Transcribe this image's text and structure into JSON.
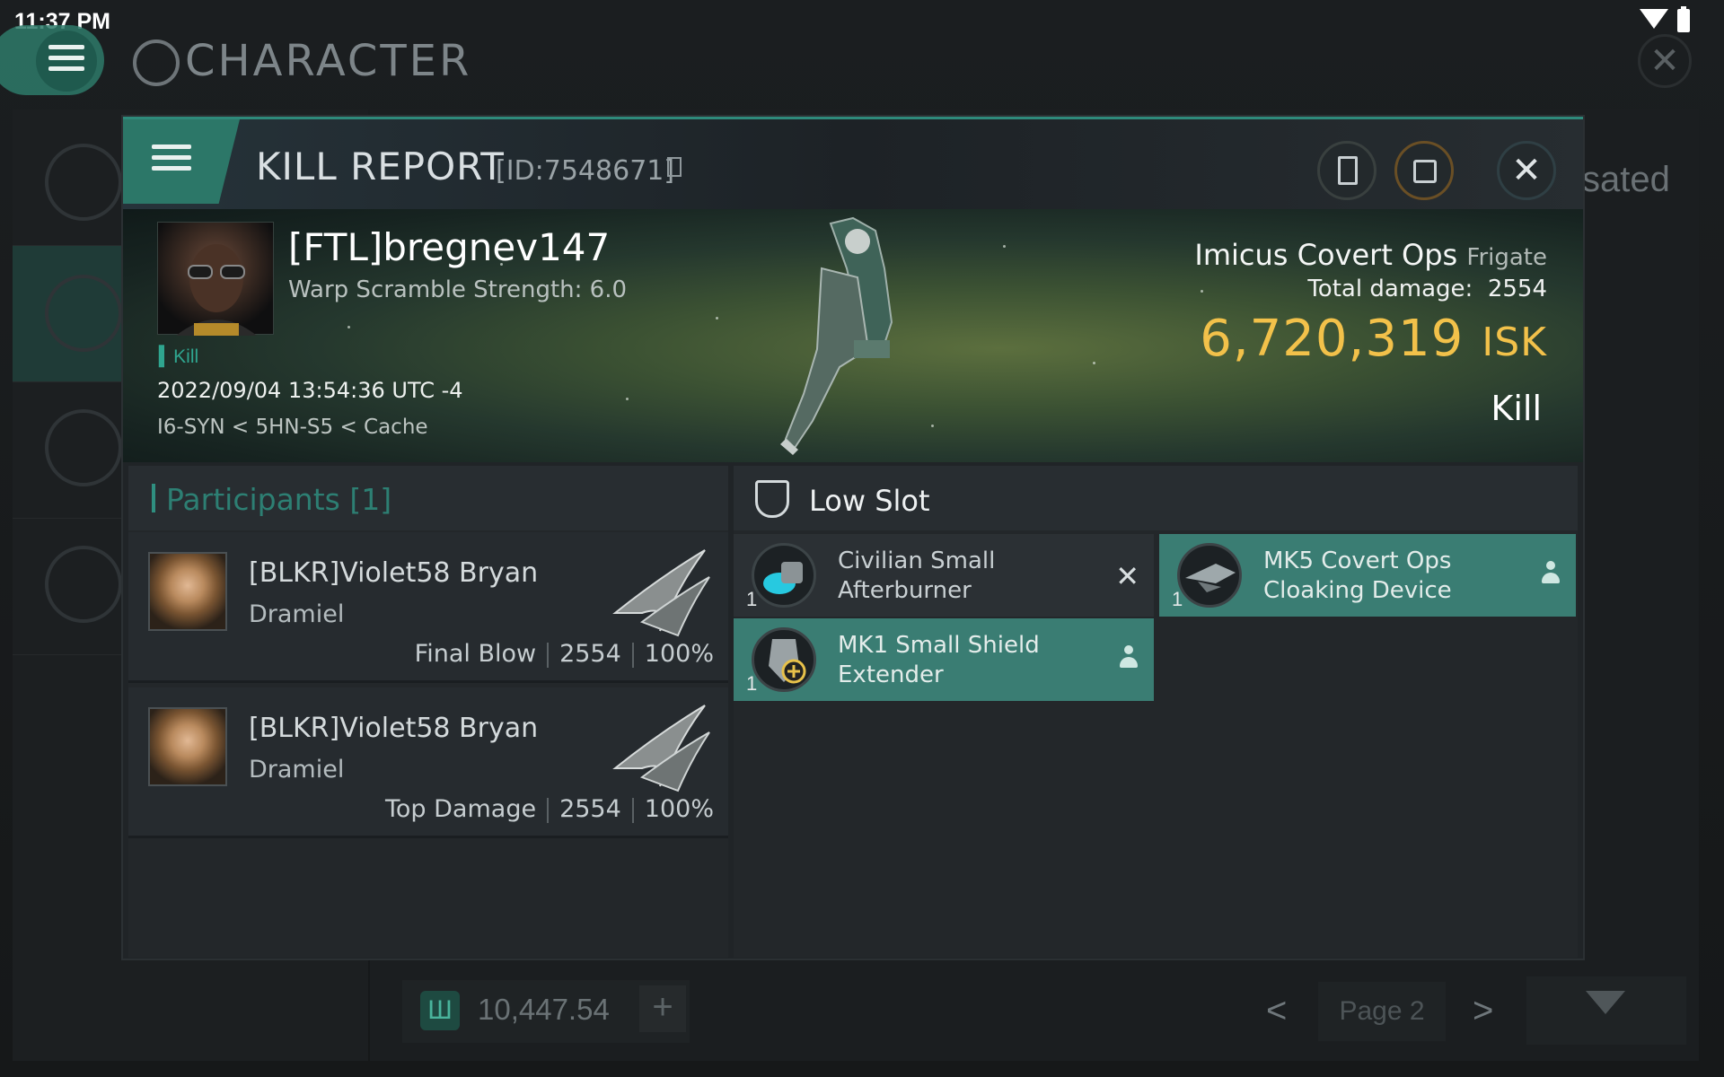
{
  "status_bar": {
    "time": "11:37 PM"
  },
  "background_app": {
    "title": "CHARACTER",
    "partial_text": "sated",
    "wallet_value": "10,447.54",
    "wallet_add": "+",
    "page_prev": "<",
    "page_label": "Page 2",
    "page_next": ">",
    "close_symbol": "✕"
  },
  "modal": {
    "title": "KILL REPORT",
    "report_id": "[ID:7548671]",
    "close_symbol": "✕"
  },
  "victim": {
    "name": "[FTL]bregnev147",
    "warp_scramble": "Warp Scramble Strength: 6.0",
    "tag": "Kill",
    "datetime": "2022/09/04 13:54:36 UTC -4",
    "location": "I6-SYN < 5HN-S5 < Cache",
    "ship_name": "Imicus Covert Ops",
    "ship_class": "Frigate",
    "total_damage_label": "Total damage:",
    "total_damage_value": "2554",
    "isk_value": "6,720,319",
    "isk_unit": "ISK",
    "result": "Kill"
  },
  "participants": {
    "title": "Participants",
    "count": "[1]",
    "rows": [
      {
        "name": "[BLKR]Violet58 Bryan",
        "ship": "Dramiel",
        "role": "Final Blow",
        "damage": "2554",
        "percent": "100%"
      },
      {
        "name": "[BLKR]Violet58 Bryan",
        "ship": "Dramiel",
        "role": "Top Damage",
        "damage": "2554",
        "percent": "100%"
      }
    ]
  },
  "fitting": {
    "slot_title": "Low Slot",
    "modules": [
      {
        "name": "Civilian Small Afterburner",
        "qty": "1",
        "state": "destroyed",
        "state_symbol": "✕"
      },
      {
        "name": "MK5 Covert Ops Cloaking Device",
        "qty": "1",
        "state": "dropped"
      },
      {
        "name": "MK1 Small Shield Extender",
        "qty": "1",
        "state": "dropped"
      }
    ]
  },
  "colors": {
    "accent_teal": "#2c7768",
    "isk_gold": "#f2c14a",
    "dropped_bg": "#3a7d73"
  },
  "icons": [
    "menu-icon",
    "character-icon",
    "wifi-icon",
    "battery-icon",
    "copy-icon",
    "notes-icon",
    "share-icon",
    "close-icon",
    "shield-slot-icon",
    "person-icon",
    "filter-icon",
    "wallet-icon"
  ]
}
